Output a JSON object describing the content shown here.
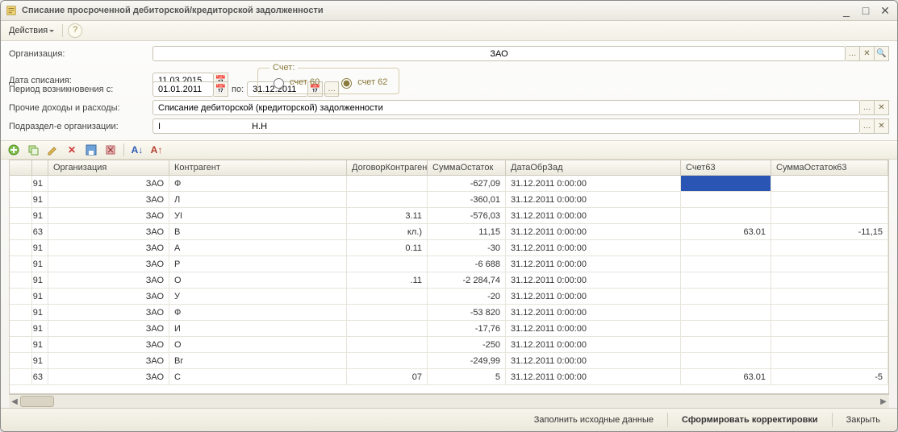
{
  "window": {
    "title": "Списание просроченной дебиторской/кредиторской задолженности"
  },
  "toolbar": {
    "actions_label": "Действия"
  },
  "form": {
    "org_label": "Организация:",
    "org_value": "ЗАО",
    "date_label": "Дата списания:",
    "date_value": "11.03.2015",
    "period_label": "Период возникновения с:",
    "period_from": "01.01.2011",
    "period_to_label": "по:",
    "period_to": "31.12.2011",
    "account_legend": "Счет:",
    "account_opt1": "счет 60",
    "account_opt2": "счет 62",
    "other_label": "Прочие доходы и расходы:",
    "other_value": "Списание дебиторской (кредиторской) задолженности",
    "subdiv_label": "Подраздел-е организации:",
    "subdiv_value": "I                                     Н.Н"
  },
  "grid": {
    "columns": [
      "",
      "",
      "Организация",
      "Контрагент",
      "ДоговорКонтрагента",
      "СуммаОстаток",
      "ДатаОбрЗад",
      "Счет63",
      "СуммаОстаток63"
    ],
    "rows": [
      {
        "n": "91",
        "org": "ЗАО",
        "agent": "Ф",
        "contract": "",
        "sum": "-627,09",
        "date": "31.12.2011 0:00:00",
        "acc63": "",
        "sum63": "",
        "sel": true
      },
      {
        "n": "91",
        "org": "ЗАО",
        "agent": "Л",
        "contract": "",
        "sum": "-360,01",
        "date": "31.12.2011 0:00:00",
        "acc63": "",
        "sum63": ""
      },
      {
        "n": "91",
        "org": "ЗАО",
        "agent": "УІ",
        "contract": "3.11",
        "sum": "-576,03",
        "date": "31.12.2011 0:00:00",
        "acc63": "",
        "sum63": ""
      },
      {
        "n": "63",
        "org": "ЗАО",
        "agent": "В",
        "contract": "кл.)",
        "sum": "11,15",
        "date": "31.12.2011 0:00:00",
        "acc63": "63.01",
        "sum63": "-11,15"
      },
      {
        "n": "91",
        "org": "ЗАО",
        "agent": "А",
        "contract": "0.11",
        "sum": "-30",
        "date": "31.12.2011 0:00:00",
        "acc63": "",
        "sum63": ""
      },
      {
        "n": "91",
        "org": "ЗАО",
        "agent": "Р",
        "contract": "",
        "sum": "-6 688",
        "date": "31.12.2011 0:00:00",
        "acc63": "",
        "sum63": ""
      },
      {
        "n": "91",
        "org": "ЗАО",
        "agent": "О",
        "contract": ".11",
        "sum": "-2 284,74",
        "date": "31.12.2011 0:00:00",
        "acc63": "",
        "sum63": ""
      },
      {
        "n": "91",
        "org": "ЗАО",
        "agent": "У",
        "contract": "",
        "sum": "-20",
        "date": "31.12.2011 0:00:00",
        "acc63": "",
        "sum63": ""
      },
      {
        "n": "91",
        "org": "ЗАО",
        "agent": "Ф",
        "contract": "",
        "sum": "-53 820",
        "date": "31.12.2011 0:00:00",
        "acc63": "",
        "sum63": ""
      },
      {
        "n": "91",
        "org": "ЗАО",
        "agent": "И",
        "contract": "",
        "sum": "-17,76",
        "date": "31.12.2011 0:00:00",
        "acc63": "",
        "sum63": ""
      },
      {
        "n": "91",
        "org": "ЗАО",
        "agent": "О",
        "contract": "",
        "sum": "-250",
        "date": "31.12.2011 0:00:00",
        "acc63": "",
        "sum63": ""
      },
      {
        "n": "91",
        "org": "ЗАО",
        "agent": "Вг",
        "contract": "",
        "sum": "-249,99",
        "date": "31.12.2011 0:00:00",
        "acc63": "",
        "sum63": ""
      },
      {
        "n": "63",
        "org": "ЗАО",
        "agent": "С",
        "contract": "07",
        "sum": "5",
        "date": "31.12.2011 0:00:00",
        "acc63": "63.01",
        "sum63": "-5"
      }
    ]
  },
  "footer": {
    "fill_label": "Заполнить исходные данные",
    "form_label": "Сформировать корректировки",
    "close_label": "Закрыть"
  }
}
